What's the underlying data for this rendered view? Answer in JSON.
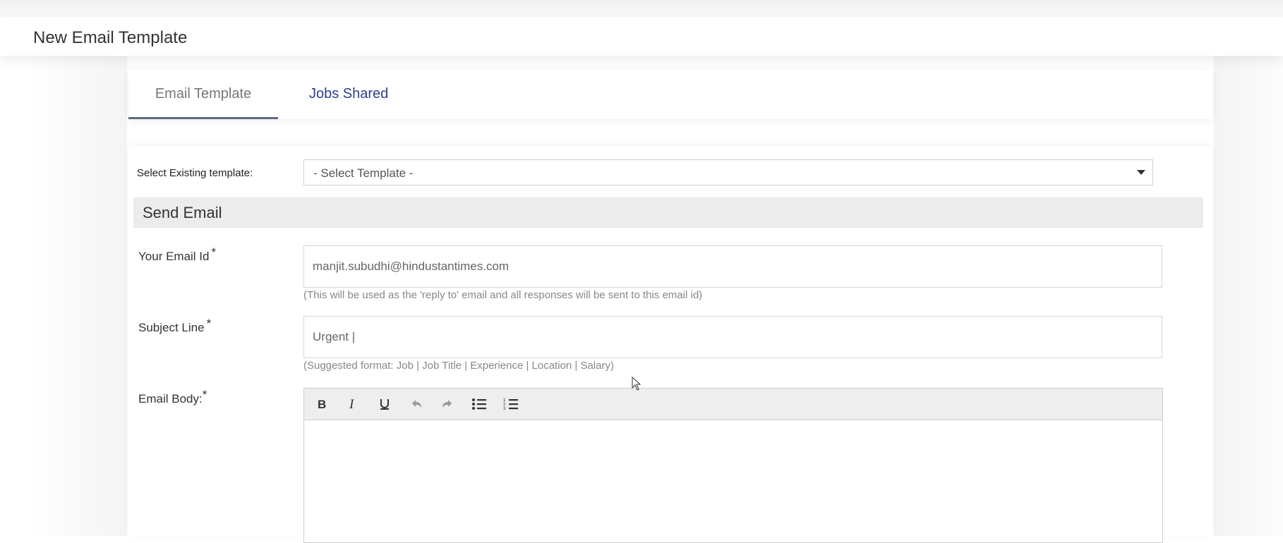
{
  "header": {
    "title": "New Email Template"
  },
  "tabs": [
    {
      "label": "Email Template",
      "active": true
    },
    {
      "label": "Jobs Shared",
      "active": false
    }
  ],
  "template_select": {
    "label": "Select Existing template:",
    "value": "- Select Template -"
  },
  "section": {
    "title": "Send Email"
  },
  "email_field": {
    "label": "Your Email Id",
    "required_mark": "*",
    "value": "manjit.subudhi@hindustantimes.com",
    "hint": "(This will be used as the 'reply to' email and all responses will be sent to this email id)"
  },
  "subject_field": {
    "label": "Subject Line",
    "required_mark": "*",
    "value": "Urgent |",
    "hint": "(Suggested format: Job | Job Title | Experience | Location | Salary)"
  },
  "body_field": {
    "label": "Email Body:",
    "required_mark": "*",
    "toolbar": [
      "bold-icon",
      "italic-icon",
      "underline-icon",
      "undo-icon",
      "redo-icon",
      "bulleted-list-icon",
      "numbered-list-icon"
    ]
  },
  "colors": {
    "active_tab_underline": "#5b6b7c",
    "link_tab": "#2d3e8a",
    "section_bar": "#ececec"
  }
}
